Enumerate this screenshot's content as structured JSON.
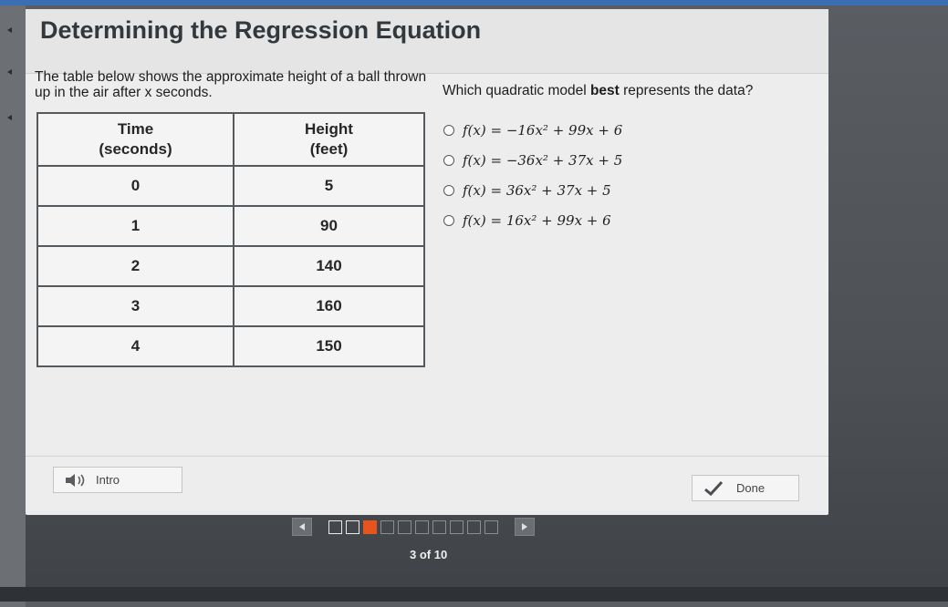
{
  "title": "Determining the Regression Equation",
  "prompt_text": "The table below shows the approximate height of a ball thrown up in the air after x seconds.",
  "question": {
    "before": "Which quadratic model ",
    "bold": "best",
    "after": " represents the data?"
  },
  "table": {
    "headers": [
      [
        "Time",
        "(seconds)"
      ],
      [
        "Height",
        "(feet)"
      ]
    ],
    "rows": [
      [
        "0",
        "5"
      ],
      [
        "1",
        "90"
      ],
      [
        "2",
        "140"
      ],
      [
        "3",
        "160"
      ],
      [
        "4",
        "150"
      ]
    ]
  },
  "options": [
    "f(x) = −16x² + 99x + 6",
    "f(x) = −36x² + 37x + 5",
    "f(x) = 36x² + 37x + 5",
    "f(x) = 16x² + 99x + 6"
  ],
  "footer": {
    "intro_label": "Intro",
    "done_label": "Done"
  },
  "pagination": {
    "label": "3 of 10",
    "current": 3,
    "total": 10
  },
  "colors": {
    "accent": "#e8541e",
    "top_strip": "#3a6fb3"
  }
}
